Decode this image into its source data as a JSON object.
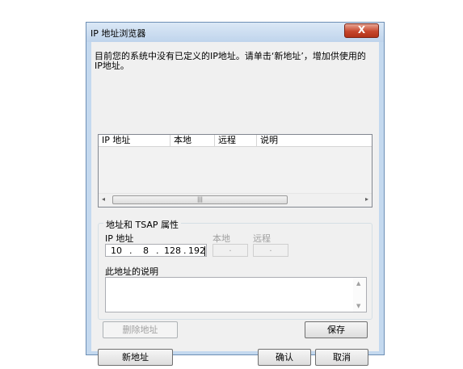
{
  "window": {
    "title": "IP 地址浏览器",
    "close_glyph": "X"
  },
  "message": "目前您的系统中没有已定义的IP地址。请单击‘新地址’，增加供使用的IP地址。",
  "list": {
    "columns": [
      "IP 地址",
      "本地",
      "远程",
      "说明"
    ],
    "rows": []
  },
  "properties": {
    "group_label": "地址和 TSAP 属性",
    "ip_label": "IP 地址",
    "ip_octets": [
      "10",
      "8",
      "128",
      "192"
    ],
    "local_label": "本地",
    "remote_label": "远程",
    "local_value": ".",
    "remote_value": ".",
    "description_label": "此地址的说明",
    "description_value": ""
  },
  "buttons": {
    "delete": "删除地址",
    "save": "保存",
    "new": "新地址",
    "ok": "确认",
    "cancel": "取消"
  },
  "icons": {
    "scroll_left": "◂",
    "scroll_right": "▸",
    "scroll_thumb_grip": "|||",
    "scroll_up": "▲",
    "scroll_down": "▼"
  },
  "colors": {
    "title_bg": "#c4d9ef",
    "close_red": "#c7472d",
    "face": "#f0f0f0"
  }
}
